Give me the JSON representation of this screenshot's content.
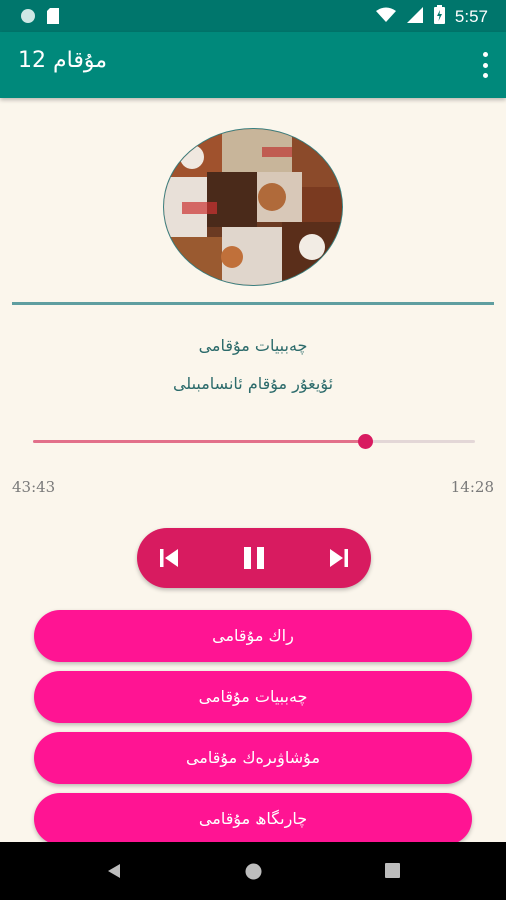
{
  "status_bar": {
    "time": "5:57",
    "icons": [
      "circle-notification-icon",
      "sd-card-icon",
      "wifi-icon",
      "signal-icon",
      "battery-icon"
    ]
  },
  "app_bar": {
    "title": "12 مۇقام",
    "menu_icon": "overflow-menu-icon"
  },
  "now_playing": {
    "title": "چەببيات مۇقامى",
    "artist": "ئۇيغۇر مۇقام ئانسامبىلى",
    "progress_fraction": 0.75,
    "time_left": "43:43",
    "time_right": "14:28"
  },
  "controls": {
    "prev_icon": "skip-previous-icon",
    "pause_icon": "pause-icon",
    "next_icon": "skip-next-icon"
  },
  "playlist": [
    {
      "label": "راك مۇقامى"
    },
    {
      "label": "چەببيات مۇقامى"
    },
    {
      "label": "مۇشاۋىرەك مۇقامى"
    },
    {
      "label": "چارىگاھ مۇقامى"
    }
  ],
  "colors": {
    "status_bar": "#00766c",
    "app_bar": "#00897b",
    "background": "#fbf6ec",
    "accent": "#d81b60",
    "playlist_button": "#ff1493",
    "text_teal": "#2c6b6b"
  },
  "nav_bar": {
    "icons": [
      "back-icon",
      "home-icon",
      "recents-icon"
    ]
  }
}
